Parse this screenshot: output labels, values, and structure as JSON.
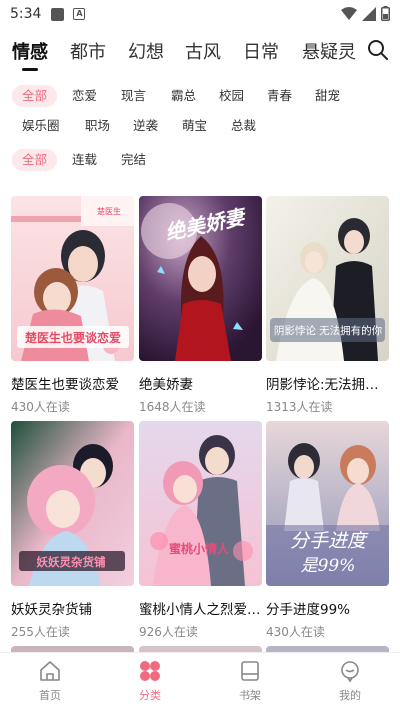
{
  "status_bar": {
    "time": "5:34",
    "a_icon_text": "A"
  },
  "category_tabs": [
    {
      "label": "情感",
      "active": true
    },
    {
      "label": "都市",
      "active": false
    },
    {
      "label": "幻想",
      "active": false
    },
    {
      "label": "古风",
      "active": false
    },
    {
      "label": "日常",
      "active": false
    },
    {
      "label": "悬疑灵",
      "active": false
    }
  ],
  "theme_filters": [
    {
      "label": "全部",
      "active": true
    },
    {
      "label": "恋爱"
    },
    {
      "label": "现言"
    },
    {
      "label": "霸总"
    },
    {
      "label": "校园"
    },
    {
      "label": "青春"
    },
    {
      "label": "甜宠"
    },
    {
      "label": "娱乐圈"
    },
    {
      "label": "职场"
    },
    {
      "label": "逆袭"
    },
    {
      "label": "萌宝"
    },
    {
      "label": "总裁"
    }
  ],
  "status_filters": [
    {
      "label": "全部",
      "active": true
    },
    {
      "label": "连载"
    },
    {
      "label": "完结"
    }
  ],
  "comics": [
    {
      "title": "楚医生也要谈恋爱",
      "readers": "430人在读",
      "cover_text": "楚医生也要谈恋爱",
      "cover_sub": "楚医生"
    },
    {
      "title": "绝美娇妻",
      "readers": "1648人在读",
      "cover_text": "绝美娇妻"
    },
    {
      "title": "阴影悖论:无法拥有的你",
      "readers": "1313人在读",
      "cover_text": "阴影悖论 无法拥有的你"
    },
    {
      "title": "妖妖灵杂货铺",
      "readers": "255人在读",
      "cover_text": "妖妖灵杂货铺"
    },
    {
      "title": "蜜桃小情人之烈爱知夏",
      "readers": "926人在读",
      "cover_text": "蜜桃小情人"
    },
    {
      "title": "分手进度99%",
      "readers": "430人在读",
      "cover_text": "分手进度",
      "cover_sub": "是99%"
    }
  ],
  "bottom_nav": [
    {
      "label": "首页",
      "icon": "home-icon",
      "active": false
    },
    {
      "label": "分类",
      "icon": "category-icon",
      "active": true
    },
    {
      "label": "书架",
      "icon": "bookshelf-icon",
      "active": false
    },
    {
      "label": "我的",
      "icon": "profile-icon",
      "active": false
    }
  ],
  "colors": {
    "accent": "#f06b7f",
    "chip_bg": "#fde8ec",
    "muted": "#888888"
  }
}
